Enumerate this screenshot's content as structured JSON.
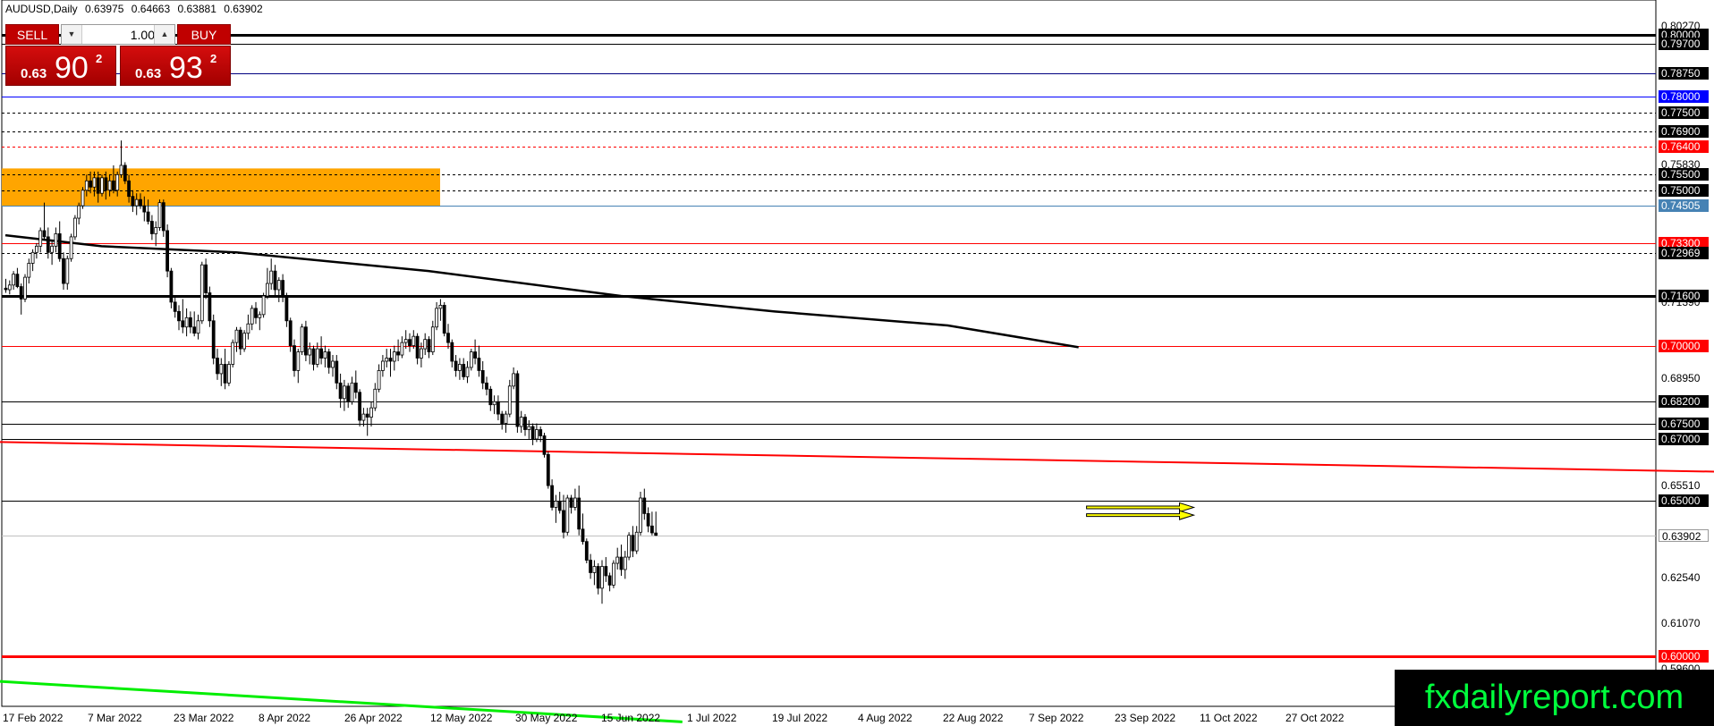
{
  "header": {
    "symbol": "AUDUSD,Daily",
    "open": "0.63975",
    "high": "0.64663",
    "low": "0.63881",
    "close": "0.63902"
  },
  "trade_panel": {
    "sell_label": "SELL",
    "buy_label": "BUY",
    "lot_value": "1.00",
    "sell_quote": {
      "prefix": "0.63",
      "big": "90",
      "sup": "2"
    },
    "buy_quote": {
      "prefix": "0.63",
      "big": "93",
      "sup": "2"
    }
  },
  "axis": {
    "y_ticks": [
      "0.80270",
      "0.75830",
      "0.71390",
      "0.68950",
      "0.65510",
      "0.62540",
      "0.61070",
      "0.59600"
    ],
    "x_ticks": [
      "17 Feb 2022",
      "7 Mar 2022",
      "23 Mar 2022",
      "8 Apr 2022",
      "26 Apr 2022",
      "12 May 2022",
      "30 May 2022",
      "15 Jun 2022",
      "1 Jul 2022",
      "19 Jul 2022",
      "4 Aug 2022",
      "22 Aug 2022",
      "7 Sep 2022",
      "23 Sep 2022",
      "11 Oct 2022",
      "27 Oct 2022"
    ]
  },
  "levels": [
    {
      "label": "0.80000",
      "color": "#000000",
      "style": "solid",
      "weight": "thick",
      "label_bg": "#000000"
    },
    {
      "label": "0.79700",
      "color": "#000000",
      "style": "solid",
      "weight": "normal",
      "label_bg": "#000000"
    },
    {
      "label": "0.78750",
      "color": "#000080",
      "style": "solid",
      "weight": "normal",
      "label_bg": "#000000"
    },
    {
      "label": "0.78000",
      "color": "#0000ff",
      "style": "solid",
      "weight": "normal",
      "label_bg": "#0000ff"
    },
    {
      "label": "0.77500",
      "color": "#000000",
      "style": "dashed",
      "weight": "normal",
      "label_bg": "#000000"
    },
    {
      "label": "0.76900",
      "color": "#000000",
      "style": "dashed",
      "weight": "normal",
      "label_bg": "#000000"
    },
    {
      "label": "0.76400",
      "color": "#ff0000",
      "style": "dashed",
      "weight": "normal",
      "label_bg": "#ff0000"
    },
    {
      "label": "0.75500",
      "color": "#000000",
      "style": "dashed",
      "weight": "normal",
      "label_bg": "#000000"
    },
    {
      "label": "0.75000",
      "color": "#000000",
      "style": "dashed",
      "weight": "normal",
      "label_bg": "#000000"
    },
    {
      "label": "0.74505",
      "color": "#4682b4",
      "style": "solid",
      "weight": "normal",
      "label_bg": "#4682b4"
    },
    {
      "label": "0.73300",
      "color": "#ff0000",
      "style": "solid",
      "weight": "normal",
      "label_bg": "#ff0000"
    },
    {
      "label": "0.72969",
      "color": "#000000",
      "style": "dashed",
      "weight": "normal",
      "label_bg": "#000000"
    },
    {
      "label": "0.71600",
      "color": "#000000",
      "style": "solid",
      "weight": "thick",
      "label_bg": "#000000"
    },
    {
      "label": "0.70000",
      "color": "#ff0000",
      "style": "solid",
      "weight": "normal",
      "label_bg": "#ff0000"
    },
    {
      "label": "0.68200",
      "color": "#000000",
      "style": "solid",
      "weight": "normal",
      "label_bg": "#000000"
    },
    {
      "label": "0.67500",
      "color": "#000000",
      "style": "solid",
      "weight": "normal",
      "label_bg": "#000000"
    },
    {
      "label": "0.67000",
      "color": "#000000",
      "style": "solid",
      "weight": "normal",
      "label_bg": "#000000"
    },
    {
      "label": "0.65000",
      "color": "#000000",
      "style": "solid",
      "weight": "normal",
      "label_bg": "#000000"
    },
    {
      "label": "0.63902",
      "color": "#c0c0c0",
      "style": "solid",
      "weight": "normal",
      "label_bg": "#ffffff"
    },
    {
      "label": "0.60000",
      "color": "#ff0000",
      "style": "solid",
      "weight": "thick",
      "label_bg": "#ff0000"
    }
  ],
  "zone": {
    "color": "#ffa500",
    "top_price": 0.757,
    "bottom_price": 0.745
  },
  "colors": {
    "background": "#ffffff",
    "candle_up": "#ffffff",
    "candle_down": "#000000",
    "moving_average": "#000000",
    "trendline_red": "#ff0000",
    "trendline_green": "#00ee00",
    "arrow_fill": "#ffff00"
  },
  "chart_data": {
    "type": "candlestick",
    "symbol": "AUDUSD",
    "timeframe": "Daily",
    "ylim": [
      0.584,
      0.806
    ],
    "candles": [
      [
        0.7185,
        0.7215,
        0.717,
        0.718
      ],
      [
        0.718,
        0.721,
        0.7165,
        0.7195
      ],
      [
        0.7195,
        0.724,
        0.718,
        0.723
      ],
      [
        0.723,
        0.725,
        0.7185,
        0.719
      ],
      [
        0.719,
        0.72,
        0.71,
        0.715
      ],
      [
        0.715,
        0.723,
        0.714,
        0.722
      ],
      [
        0.722,
        0.728,
        0.72,
        0.7265
      ],
      [
        0.7265,
        0.731,
        0.724,
        0.73
      ],
      [
        0.73,
        0.733,
        0.728,
        0.732
      ],
      [
        0.732,
        0.738,
        0.73,
        0.737
      ],
      [
        0.737,
        0.746,
        0.734,
        0.735
      ],
      [
        0.735,
        0.738,
        0.728,
        0.73
      ],
      [
        0.73,
        0.734,
        0.726,
        0.732
      ],
      [
        0.732,
        0.738,
        0.73,
        0.736
      ],
      [
        0.736,
        0.74,
        0.727,
        0.728
      ],
      [
        0.728,
        0.73,
        0.718,
        0.72
      ],
      [
        0.72,
        0.729,
        0.718,
        0.728
      ],
      [
        0.728,
        0.736,
        0.727,
        0.735
      ],
      [
        0.735,
        0.742,
        0.734,
        0.741
      ],
      [
        0.741,
        0.746,
        0.739,
        0.745
      ],
      [
        0.745,
        0.751,
        0.744,
        0.75
      ],
      [
        0.75,
        0.755,
        0.748,
        0.753
      ],
      [
        0.753,
        0.756,
        0.749,
        0.751
      ],
      [
        0.751,
        0.756,
        0.748,
        0.754
      ],
      [
        0.754,
        0.756,
        0.746,
        0.749
      ],
      [
        0.749,
        0.755,
        0.748,
        0.754
      ],
      [
        0.754,
        0.756,
        0.747,
        0.75
      ],
      [
        0.75,
        0.755,
        0.748,
        0.753
      ],
      [
        0.753,
        0.758,
        0.749,
        0.75
      ],
      [
        0.75,
        0.756,
        0.748,
        0.755
      ],
      [
        0.755,
        0.766,
        0.754,
        0.758
      ],
      [
        0.758,
        0.759,
        0.752,
        0.753
      ],
      [
        0.753,
        0.755,
        0.746,
        0.748
      ],
      [
        0.748,
        0.75,
        0.743,
        0.745
      ],
      [
        0.745,
        0.749,
        0.742,
        0.747
      ],
      [
        0.747,
        0.749,
        0.744,
        0.745
      ],
      [
        0.745,
        0.748,
        0.74,
        0.743
      ],
      [
        0.743,
        0.747,
        0.739,
        0.74
      ],
      [
        0.74,
        0.742,
        0.734,
        0.736
      ],
      [
        0.736,
        0.74,
        0.732,
        0.738
      ],
      [
        0.738,
        0.747,
        0.737,
        0.746
      ],
      [
        0.746,
        0.747,
        0.735,
        0.737
      ],
      [
        0.737,
        0.739,
        0.722,
        0.724
      ],
      [
        0.724,
        0.725,
        0.712,
        0.714
      ],
      [
        0.714,
        0.716,
        0.709,
        0.711
      ],
      [
        0.711,
        0.713,
        0.705,
        0.708
      ],
      [
        0.708,
        0.715,
        0.704,
        0.706
      ],
      [
        0.706,
        0.712,
        0.703,
        0.709
      ],
      [
        0.709,
        0.711,
        0.704,
        0.706
      ],
      [
        0.706,
        0.711,
        0.703,
        0.704
      ],
      [
        0.704,
        0.71,
        0.702,
        0.708
      ],
      [
        0.708,
        0.727,
        0.707,
        0.726
      ],
      [
        0.726,
        0.728,
        0.715,
        0.717
      ],
      [
        0.717,
        0.719,
        0.706,
        0.708
      ],
      [
        0.708,
        0.71,
        0.694,
        0.696
      ],
      [
        0.696,
        0.699,
        0.689,
        0.691
      ],
      [
        0.691,
        0.696,
        0.687,
        0.694
      ],
      [
        0.694,
        0.699,
        0.686,
        0.688
      ],
      [
        0.688,
        0.695,
        0.687,
        0.694
      ],
      [
        0.694,
        0.702,
        0.693,
        0.701
      ],
      [
        0.701,
        0.706,
        0.698,
        0.705
      ],
      [
        0.705,
        0.706,
        0.697,
        0.699
      ],
      [
        0.699,
        0.705,
        0.698,
        0.704
      ],
      [
        0.704,
        0.71,
        0.702,
        0.707
      ],
      [
        0.707,
        0.713,
        0.705,
        0.712
      ],
      [
        0.712,
        0.714,
        0.707,
        0.709
      ],
      [
        0.709,
        0.711,
        0.705,
        0.71
      ],
      [
        0.71,
        0.717,
        0.709,
        0.716
      ],
      [
        0.716,
        0.725,
        0.715,
        0.72
      ],
      [
        0.72,
        0.728,
        0.718,
        0.724
      ],
      [
        0.724,
        0.726,
        0.716,
        0.718
      ],
      [
        0.718,
        0.722,
        0.714,
        0.721
      ],
      [
        0.721,
        0.723,
        0.714,
        0.716
      ],
      [
        0.716,
        0.717,
        0.706,
        0.708
      ],
      [
        0.708,
        0.709,
        0.698,
        0.7
      ],
      [
        0.7,
        0.702,
        0.69,
        0.692
      ],
      [
        0.692,
        0.699,
        0.688,
        0.698
      ],
      [
        0.698,
        0.707,
        0.697,
        0.706
      ],
      [
        0.706,
        0.708,
        0.695,
        0.697
      ],
      [
        0.697,
        0.701,
        0.694,
        0.699
      ],
      [
        0.699,
        0.7,
        0.692,
        0.694
      ],
      [
        0.694,
        0.701,
        0.693,
        0.699
      ],
      [
        0.699,
        0.703,
        0.694,
        0.696
      ],
      [
        0.696,
        0.7,
        0.693,
        0.698
      ],
      [
        0.698,
        0.699,
        0.691,
        0.693
      ],
      [
        0.693,
        0.697,
        0.69,
        0.695
      ],
      [
        0.695,
        0.697,
        0.686,
        0.688
      ],
      [
        0.688,
        0.691,
        0.68,
        0.683
      ],
      [
        0.683,
        0.689,
        0.679,
        0.687
      ],
      [
        0.687,
        0.688,
        0.68,
        0.682
      ],
      [
        0.682,
        0.69,
        0.681,
        0.688
      ],
      [
        0.688,
        0.692,
        0.683,
        0.685
      ],
      [
        0.685,
        0.686,
        0.674,
        0.676
      ],
      [
        0.676,
        0.68,
        0.674,
        0.678
      ],
      [
        0.678,
        0.68,
        0.671,
        0.677
      ],
      [
        0.677,
        0.682,
        0.674,
        0.68
      ],
      [
        0.68,
        0.688,
        0.679,
        0.686
      ],
      [
        0.686,
        0.694,
        0.685,
        0.692
      ],
      [
        0.692,
        0.697,
        0.69,
        0.695
      ],
      [
        0.695,
        0.699,
        0.693,
        0.696
      ],
      [
        0.696,
        0.699,
        0.69,
        0.695
      ],
      [
        0.695,
        0.7,
        0.692,
        0.698
      ],
      [
        0.698,
        0.702,
        0.695,
        0.697
      ],
      [
        0.697,
        0.703,
        0.696,
        0.701
      ],
      [
        0.701,
        0.705,
        0.699,
        0.702
      ],
      [
        0.702,
        0.704,
        0.698,
        0.7
      ],
      [
        0.7,
        0.705,
        0.699,
        0.703
      ],
      [
        0.703,
        0.704,
        0.694,
        0.696
      ],
      [
        0.696,
        0.701,
        0.693,
        0.699
      ],
      [
        0.699,
        0.704,
        0.697,
        0.702
      ],
      [
        0.702,
        0.703,
        0.696,
        0.698
      ],
      [
        0.698,
        0.708,
        0.697,
        0.706
      ],
      [
        0.706,
        0.714,
        0.705,
        0.712
      ],
      [
        0.712,
        0.715,
        0.708,
        0.713
      ],
      [
        0.713,
        0.714,
        0.703,
        0.704
      ],
      [
        0.704,
        0.707,
        0.699,
        0.701
      ],
      [
        0.701,
        0.702,
        0.693,
        0.695
      ],
      [
        0.695,
        0.697,
        0.69,
        0.692
      ],
      [
        0.692,
        0.696,
        0.689,
        0.694
      ],
      [
        0.694,
        0.696,
        0.689,
        0.69
      ],
      [
        0.69,
        0.695,
        0.688,
        0.693
      ],
      [
        0.693,
        0.699,
        0.692,
        0.698
      ],
      [
        0.698,
        0.702,
        0.694,
        0.696
      ],
      [
        0.696,
        0.7,
        0.69,
        0.692
      ],
      [
        0.692,
        0.695,
        0.686,
        0.688
      ],
      [
        0.688,
        0.69,
        0.684,
        0.686
      ],
      [
        0.686,
        0.687,
        0.679,
        0.681
      ],
      [
        0.681,
        0.684,
        0.678,
        0.682
      ],
      [
        0.682,
        0.684,
        0.676,
        0.678
      ],
      [
        0.678,
        0.679,
        0.673,
        0.675
      ],
      [
        0.675,
        0.679,
        0.672,
        0.678
      ],
      [
        0.678,
        0.689,
        0.677,
        0.687
      ],
      [
        0.687,
        0.693,
        0.686,
        0.691
      ],
      [
        0.691,
        0.692,
        0.672,
        0.674
      ],
      [
        0.674,
        0.679,
        0.672,
        0.677
      ],
      [
        0.677,
        0.678,
        0.671,
        0.673
      ],
      [
        0.673,
        0.676,
        0.67,
        0.674
      ],
      [
        0.674,
        0.675,
        0.668,
        0.67
      ],
      [
        0.67,
        0.675,
        0.669,
        0.673
      ],
      [
        0.673,
        0.674,
        0.669,
        0.671
      ],
      [
        0.671,
        0.672,
        0.664,
        0.665
      ],
      [
        0.665,
        0.666,
        0.654,
        0.655
      ],
      [
        0.655,
        0.657,
        0.647,
        0.648
      ],
      [
        0.648,
        0.652,
        0.643,
        0.65
      ],
      [
        0.65,
        0.653,
        0.646,
        0.647
      ],
      [
        0.647,
        0.652,
        0.638,
        0.64
      ],
      [
        0.64,
        0.652,
        0.639,
        0.651
      ],
      [
        0.651,
        0.652,
        0.646,
        0.648
      ],
      [
        0.648,
        0.654,
        0.647,
        0.651
      ],
      [
        0.651,
        0.655,
        0.639,
        0.641
      ],
      [
        0.641,
        0.646,
        0.636,
        0.637
      ],
      [
        0.637,
        0.638,
        0.63,
        0.631
      ],
      [
        0.631,
        0.633,
        0.625,
        0.627
      ],
      [
        0.627,
        0.631,
        0.623,
        0.629
      ],
      [
        0.629,
        0.63,
        0.62,
        0.622
      ],
      [
        0.622,
        0.631,
        0.617,
        0.629
      ],
      [
        0.629,
        0.632,
        0.624,
        0.626
      ],
      [
        0.626,
        0.627,
        0.621,
        0.623
      ],
      [
        0.623,
        0.631,
        0.622,
        0.63
      ],
      [
        0.63,
        0.635,
        0.628,
        0.632
      ],
      [
        0.632,
        0.636,
        0.626,
        0.628
      ],
      [
        0.628,
        0.634,
        0.625,
        0.632
      ],
      [
        0.632,
        0.64,
        0.631,
        0.639
      ],
      [
        0.639,
        0.642,
        0.632,
        0.634
      ],
      [
        0.634,
        0.642,
        0.633,
        0.64
      ],
      [
        0.64,
        0.653,
        0.639,
        0.651
      ],
      [
        0.651,
        0.654,
        0.644,
        0.646
      ],
      [
        0.646,
        0.648,
        0.64,
        0.642
      ],
      [
        0.642,
        0.6466,
        0.639,
        0.6398
      ],
      [
        0.63975,
        0.64663,
        0.63881,
        0.63902
      ]
    ],
    "moving_average": [
      [
        0,
        0.7355
      ],
      [
        25,
        0.732
      ],
      [
        60,
        0.73
      ],
      [
        110,
        0.724
      ],
      [
        160,
        0.716
      ],
      [
        200,
        0.711
      ],
      [
        245,
        0.7065
      ],
      [
        279,
        0.6995
      ]
    ],
    "trendline_red": [
      [
        0,
        0.669
      ],
      [
        460,
        0.659
      ]
    ],
    "trendline_green": [
      [
        0,
        0.592
      ],
      [
        176,
        0.579
      ]
    ],
    "arrows": [
      {
        "start_bar": 282,
        "end_bar": 295,
        "price": 0.648
      },
      {
        "start_bar": 282,
        "end_bar": 295,
        "price": 0.6455
      }
    ]
  },
  "watermark": "fxdailyreport.com"
}
